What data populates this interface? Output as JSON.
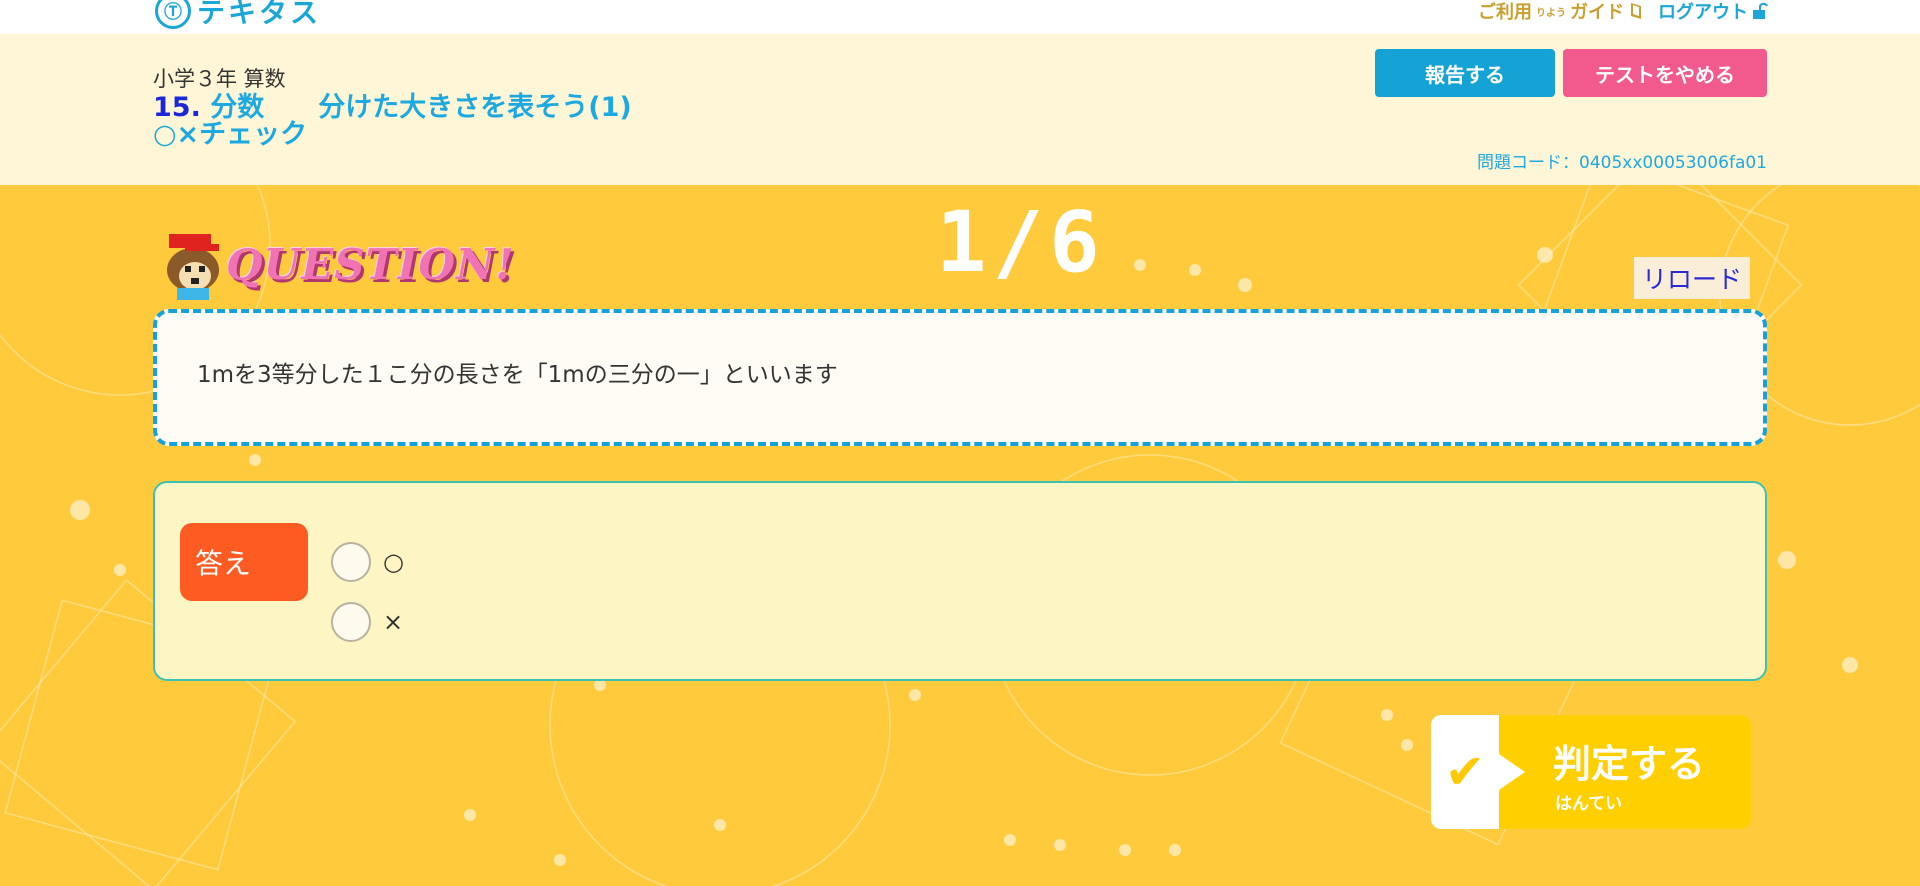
{
  "top": {
    "logo_mark": "Ⓣ",
    "logo_text": "テキタス",
    "guide_label": "ご利用",
    "guide_ruby": "りよう",
    "guide_label2": "ガイド",
    "guide_icon": "book-icon",
    "logout_label": "ログアウト",
    "logout_icon": "lock-icon"
  },
  "header": {
    "grade": "小学３年 算数",
    "lesson_number": "15.",
    "lesson_title": "分数　　分けた大きさを表そう(1)",
    "subtitle": "○×チェック",
    "report_button": "報告する",
    "quit_button": "テストをやめる",
    "problem_code": "問題コード：0405xx00053006fa01"
  },
  "question": {
    "logo": "QUESTION!",
    "progress": "1/6",
    "reload_button": "リロード",
    "text": "1mを3等分した１こ分の長さを「1mの三分の一」といいます"
  },
  "answer": {
    "label": "答え",
    "options": [
      {
        "label": "○"
      },
      {
        "label": "×"
      }
    ]
  },
  "judge": {
    "check": "✔",
    "label": "判定する",
    "ruby": "はんてい"
  },
  "colors": {
    "background": "#ffcb3d",
    "header_bg": "#fff6d8",
    "accent_blue": "#16a1dc",
    "quit_pink": "#f2598c",
    "answer_orange": "#fe5b22",
    "judge_yellow": "#ffcf00"
  }
}
